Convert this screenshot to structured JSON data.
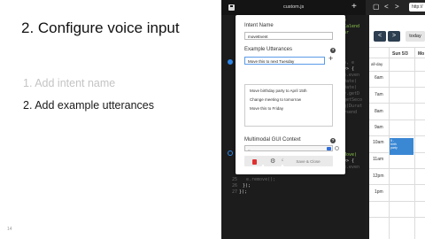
{
  "slide": {
    "title": "2. Configure voice input",
    "steps": [
      "1.  Add intent name",
      "2.  Add example utterances"
    ],
    "page_number": "14"
  },
  "editor": {
    "filename": "custom.js",
    "code_lines": [
      {
        "text": "e",
        "color": "green"
      },
      {
        "text": "Calend",
        "color": "green"
      },
      {
        "text": "ar",
        "color": "green"
      },
      {
        "text": "n, e",
        "color": "gray"
      },
      {
        "text": "=> {",
        "color": "white"
      },
      {
        "text": "e.even",
        "color": "gray"
      },
      {
        "text": "Date)",
        "color": "gray"
      },
      {
        "text": "Date)",
        "color": "gray"
      },
      {
        "text": "y.getD",
        "color": "gray"
      },
      {
        "text": "getSeco",
        "color": "gray"
      },
      {
        "text": "g(Durat",
        "color": "gray"
      },
      {
        "text": "ysend",
        "color": "gray"
      },
      {
        "text": "Move)",
        "color": "green"
      },
      {
        "text": "=> {",
        "color": "white"
      },
      {
        "text": "e.even",
        "color": "gray"
      },
      {
        "text": "e.remove();",
        "color": "gray"
      },
      {
        "text": "});",
        "color": "white"
      },
      {
        "text": "});",
        "color": "white"
      }
    ],
    "line_numbers": [
      "25",
      "26",
      "27"
    ]
  },
  "modal": {
    "intent_name_label": "Intent Name",
    "intent_name_value": "moveEvent",
    "utterances_label": "Example Utterances",
    "utterance_input_value": "Move this to next Tuesday",
    "utterances": [
      "Move birthday party to April 15th",
      "Change meeting to tomorrow",
      "Move this to Friday"
    ],
    "gui_context_label": "Multimodal GUI Context",
    "gui_context_value": "--",
    "edit_model_label": "Edit Model",
    "save_close_label": "Save & Close"
  },
  "calendar": {
    "url": "http://",
    "today_label": "today",
    "prev_label": "<",
    "next_label": ">",
    "day_headers": [
      "Sun 5/3",
      "Mo"
    ],
    "all_day_label": "all-day",
    "times": [
      "6am",
      "7am",
      "8am",
      "9am",
      "10am",
      "11am",
      "12pm",
      "1pm"
    ],
    "event_text": "5 -\nbirth\nparty"
  },
  "colors": {
    "accent_blue": "#2f86e8",
    "event_blue": "#3a87d4",
    "nav_button": "#2c3e50",
    "delete_red": "#e03030",
    "code_green": "#8ac24e"
  }
}
